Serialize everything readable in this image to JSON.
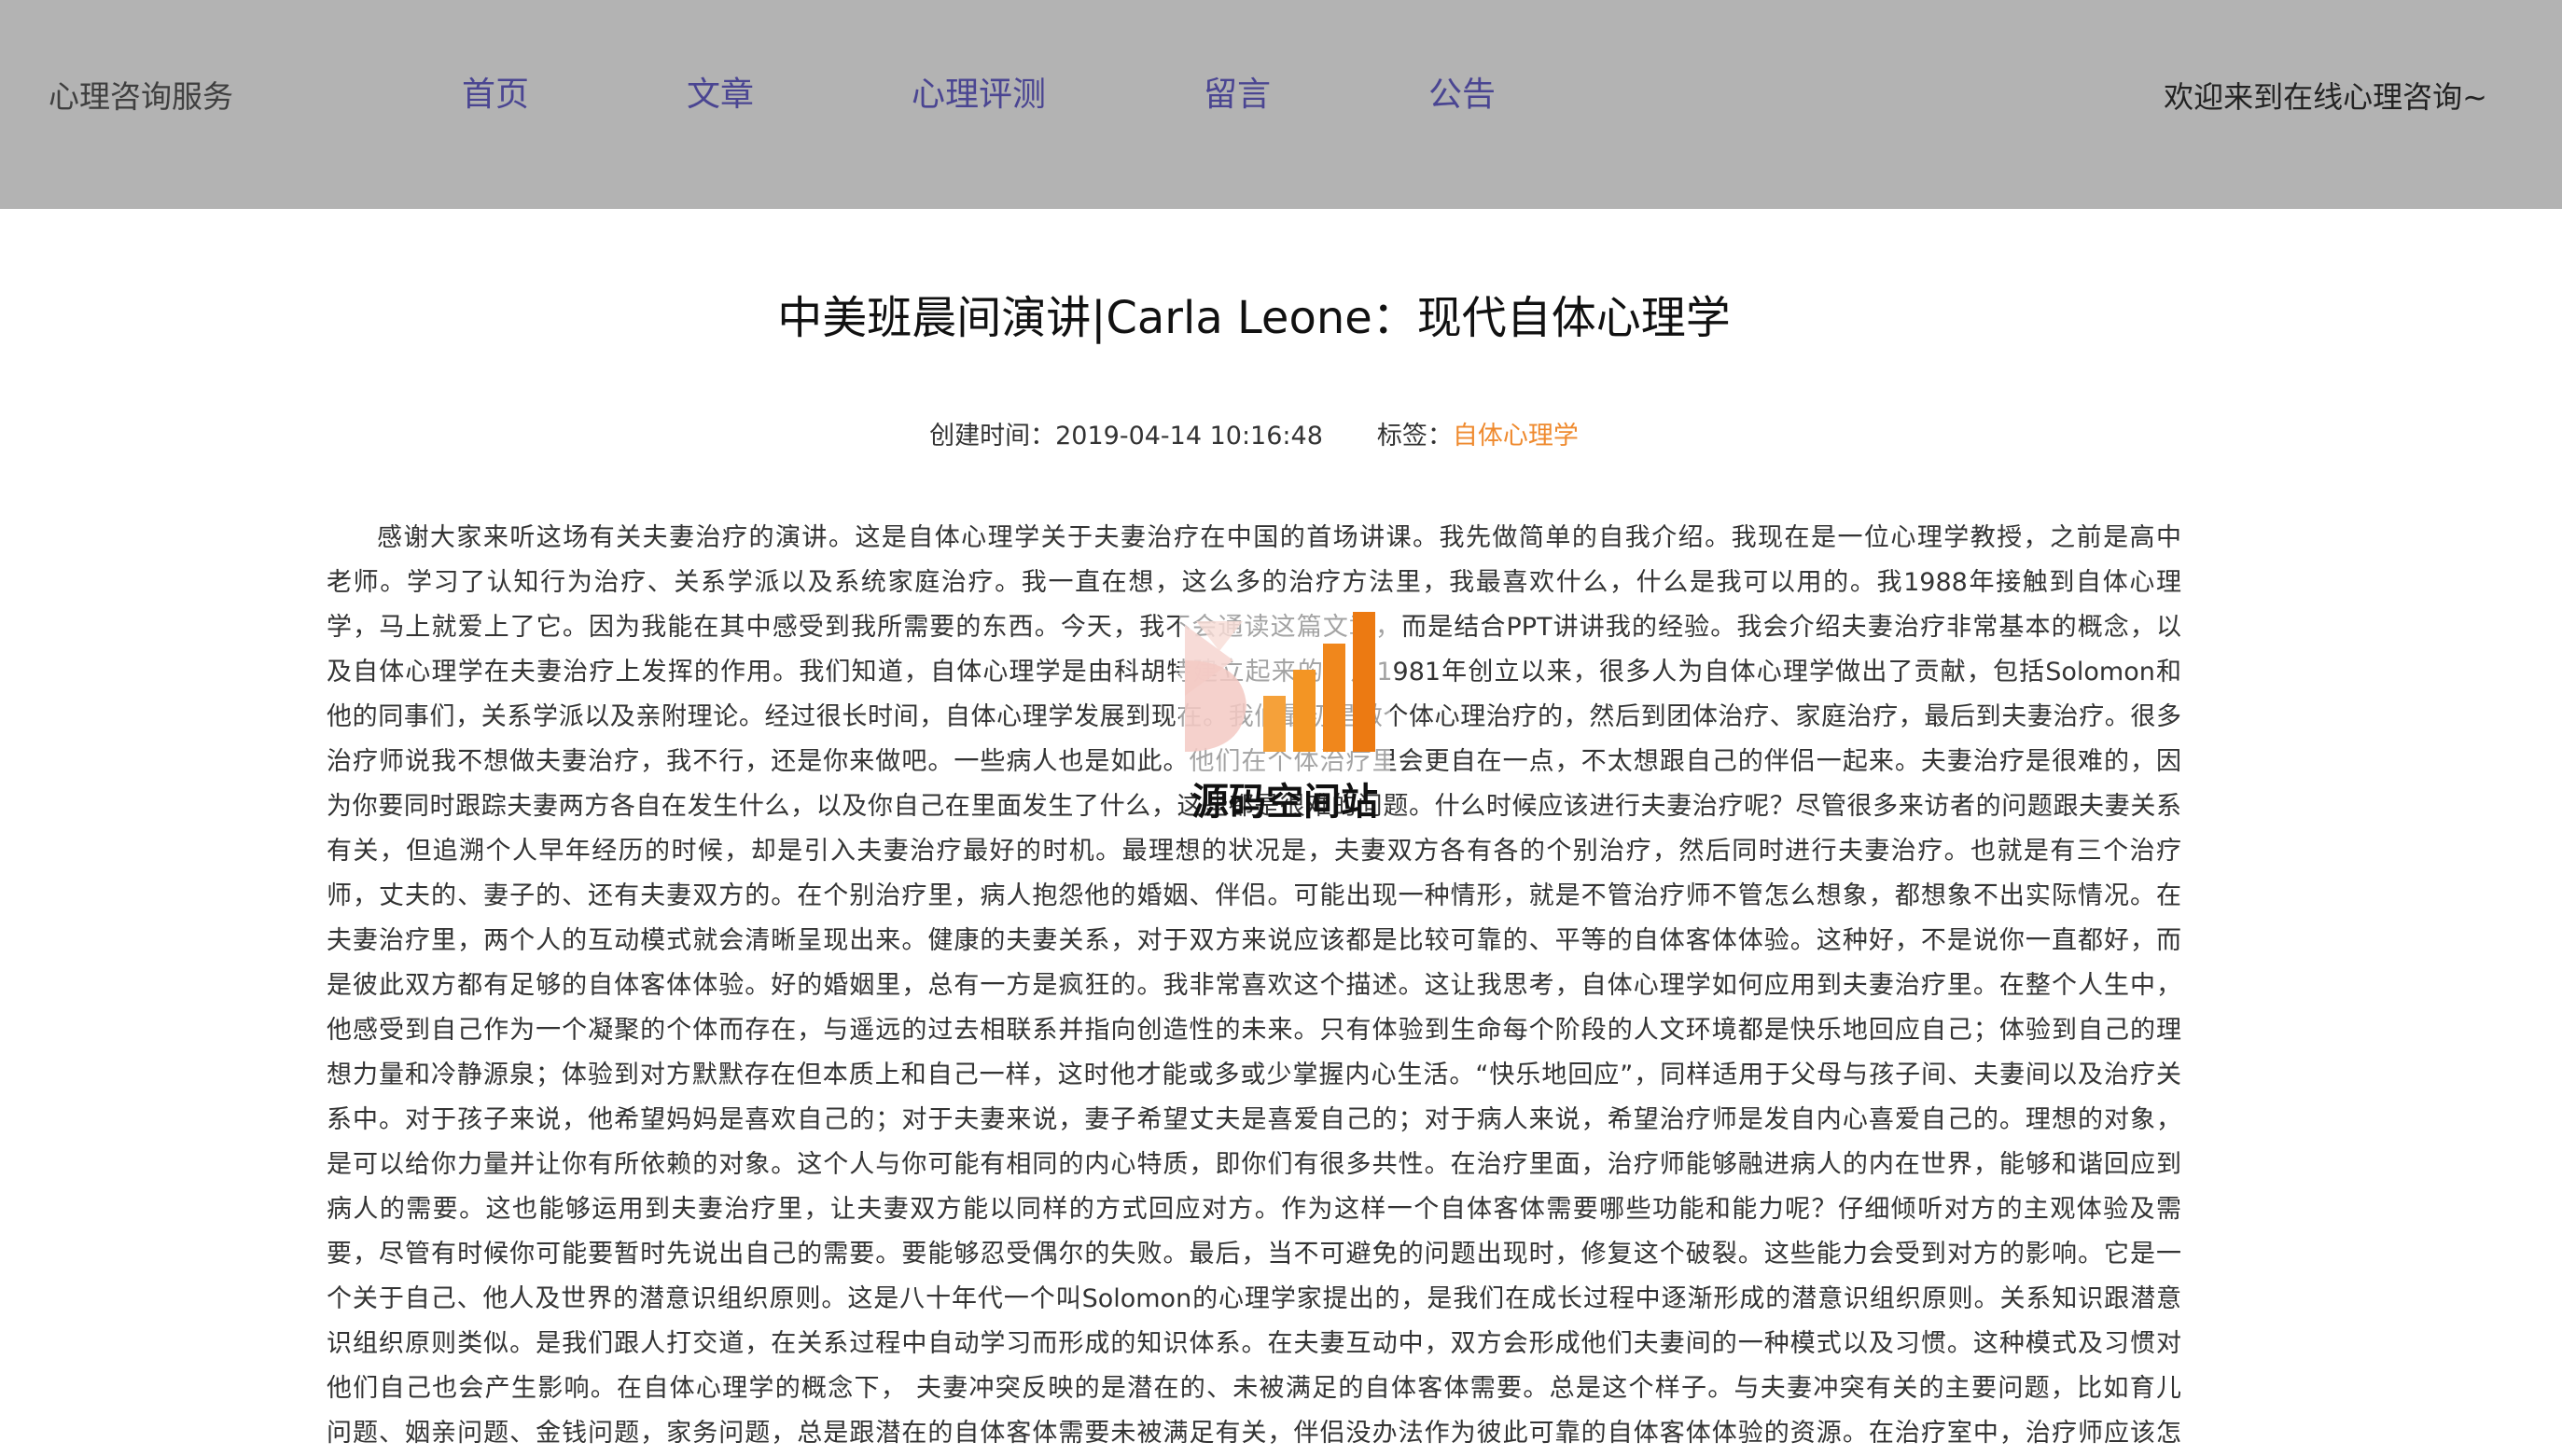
{
  "header": {
    "site_name": "心理咨询服务",
    "nav": [
      "首页",
      "文章",
      "心理评测",
      "留言",
      "公告"
    ],
    "welcome": "欢迎来到在线心理咨询~"
  },
  "article": {
    "title": "中美班晨间演讲|Carla Leone：现代自体心理学",
    "created_label": "创建时间：",
    "created_at": "2019-04-14 10:16:48",
    "tag_label": "标签：",
    "tag": "自体心理学",
    "lines": [
      "感谢大家来听这场有关夫妻治疗的演讲。这是自体心理学关于夫妻治疗在中国的首场讲课。我先做简单的自我介绍。我现在是一位心理学教授，之前是高中",
      "老师。学习了认知行为治疗、关系学派以及系统家庭治疗。我一直在想，这么多的治疗方法里，我最喜欢什么，什么是我可以用的。我1988年接触到自体心理",
      "学，马上就爱上了它。因为我能在其中感受到我所需要的东西。今天，我不会通读这篇文章，而是结合PPT讲讲我的经验。我会介绍夫妻治疗非常基本的概念，以",
      "及自体心理学在夫妻治疗上发挥的作用。我们知道，自体心理学是由科胡特建立起来的，从1981年创立以来，很多人为自体心理学做出了贡献，包括Solomon和",
      "他的同事们，关系学派以及亲附理论。经过很长时间，自体心理学发展到现在。我们最初是做个体心理治疗的，然后到团体治疗、家庭治疗，最后到夫妻治疗。很多",
      "治疗师说我不想做夫妻治疗，我不行，还是你来做吧。一些病人也是如此。他们在个体治疗里会更自在一点，不太想跟自己的伴侣一起来。夫妻治疗是很难的，因",
      "为你要同时跟踪夫妻两方各自在发生什么，以及你自己在里面发生了什么，这些都是很难的问题。什么时候应该进行夫妻治疗呢？尽管很多来访者的问题跟夫妻关系",
      "有关，但追溯个人早年经历的时候，却是引入夫妻治疗最好的时机。最理想的状况是，夫妻双方各有各的个别治疗，然后同时进行夫妻治疗。也就是有三个治疗",
      "师，丈夫的、妻子的、还有夫妻双方的。在个别治疗里，病人抱怨他的婚姻、伴侣。可能出现一种情形，就是不管治疗师不管怎么想象，都想象不出实际情况。在",
      "夫妻治疗里，两个人的互动模式就会清晰呈现出来。健康的夫妻关系，对于双方来说应该都是比较可靠的、平等的自体客体体验。这种好，不是说你一直都好，而",
      "是彼此双方都有足够的自体客体体验。好的婚姻里，总有一方是疯狂的。我非常喜欢这个描述。这让我思考，自体心理学如何应用到夫妻治疗里。在整个人生中，",
      "他感受到自己作为一个凝聚的个体而存在，与遥远的过去相联系并指向创造性的未来。只有体验到生命每个阶段的人文环境都是快乐地回应自己；体验到自己的理",
      "想力量和冷静源泉；体验到对方默默存在但本质上和自己一样，这时他才能或多或少掌握内心生活。“快乐地回应”，同样适用于父母与孩子间、夫妻间以及治疗关",
      "系中。对于孩子来说，他希望妈妈是喜欢自己的；对于夫妻来说，妻子希望丈夫是喜爱自己的；对于病人来说，希望治疗师是发自内心喜爱自己的。理想的对象，",
      "是可以给你力量并让你有所依赖的对象。这个人与你可能有相同的内心特质，即你们有很多共性。在治疗里面，治疗师能够融进病人的内在世界，能够和谐回应到",
      "病人的需要。这也能够运用到夫妻治疗里，让夫妻双方能以同样的方式回应对方。作为这样一个自体客体需要哪些功能和能力呢？仔细倾听对方的主观体验及需",
      "要，尽管有时候你可能要暂时先说出自己的需要。要能够忍受偶尔的失败。最后，当不可避免的问题出现时，修复这个破裂。这些能力会受到对方的影响。它是一",
      "个关于自己、他人及世界的潜意识组织原则。这是八十年代一个叫Solomon的心理学家提出的，是我们在成长过程中逐渐形成的潜意识组织原则。关系知识跟潜意",
      "识组织原则类似。是我们跟人打交道，在关系过程中自动学习而形成的知识体系。在夫妻互动中，双方会形成他们夫妻间的一种模式以及习惯。这种模式及习惯对",
      "他们自己也会产生影响。在自体心理学的概念下， 夫妻冲突反映的是潜在的、未被满足的自体客体需要。总是这个样子。与夫妻冲突有关的主要问题，比如育儿",
      "问题、姻亲问题、金钱问题，家务问题，总是跟潜在的自体客体需要未被满足有关，伴侣没办法作为彼此可靠的自体客体体验的资源。在治疗室中，治疗师应该怎"
    ]
  },
  "watermark": {
    "text": "源码空间站",
    "icon": "bar-chart-logo-icon"
  },
  "colors": {
    "header_bg": "#b3b3b3",
    "nav_text": "#4a4592",
    "tag_text": "#ef8a2e",
    "body_text": "#333333"
  }
}
